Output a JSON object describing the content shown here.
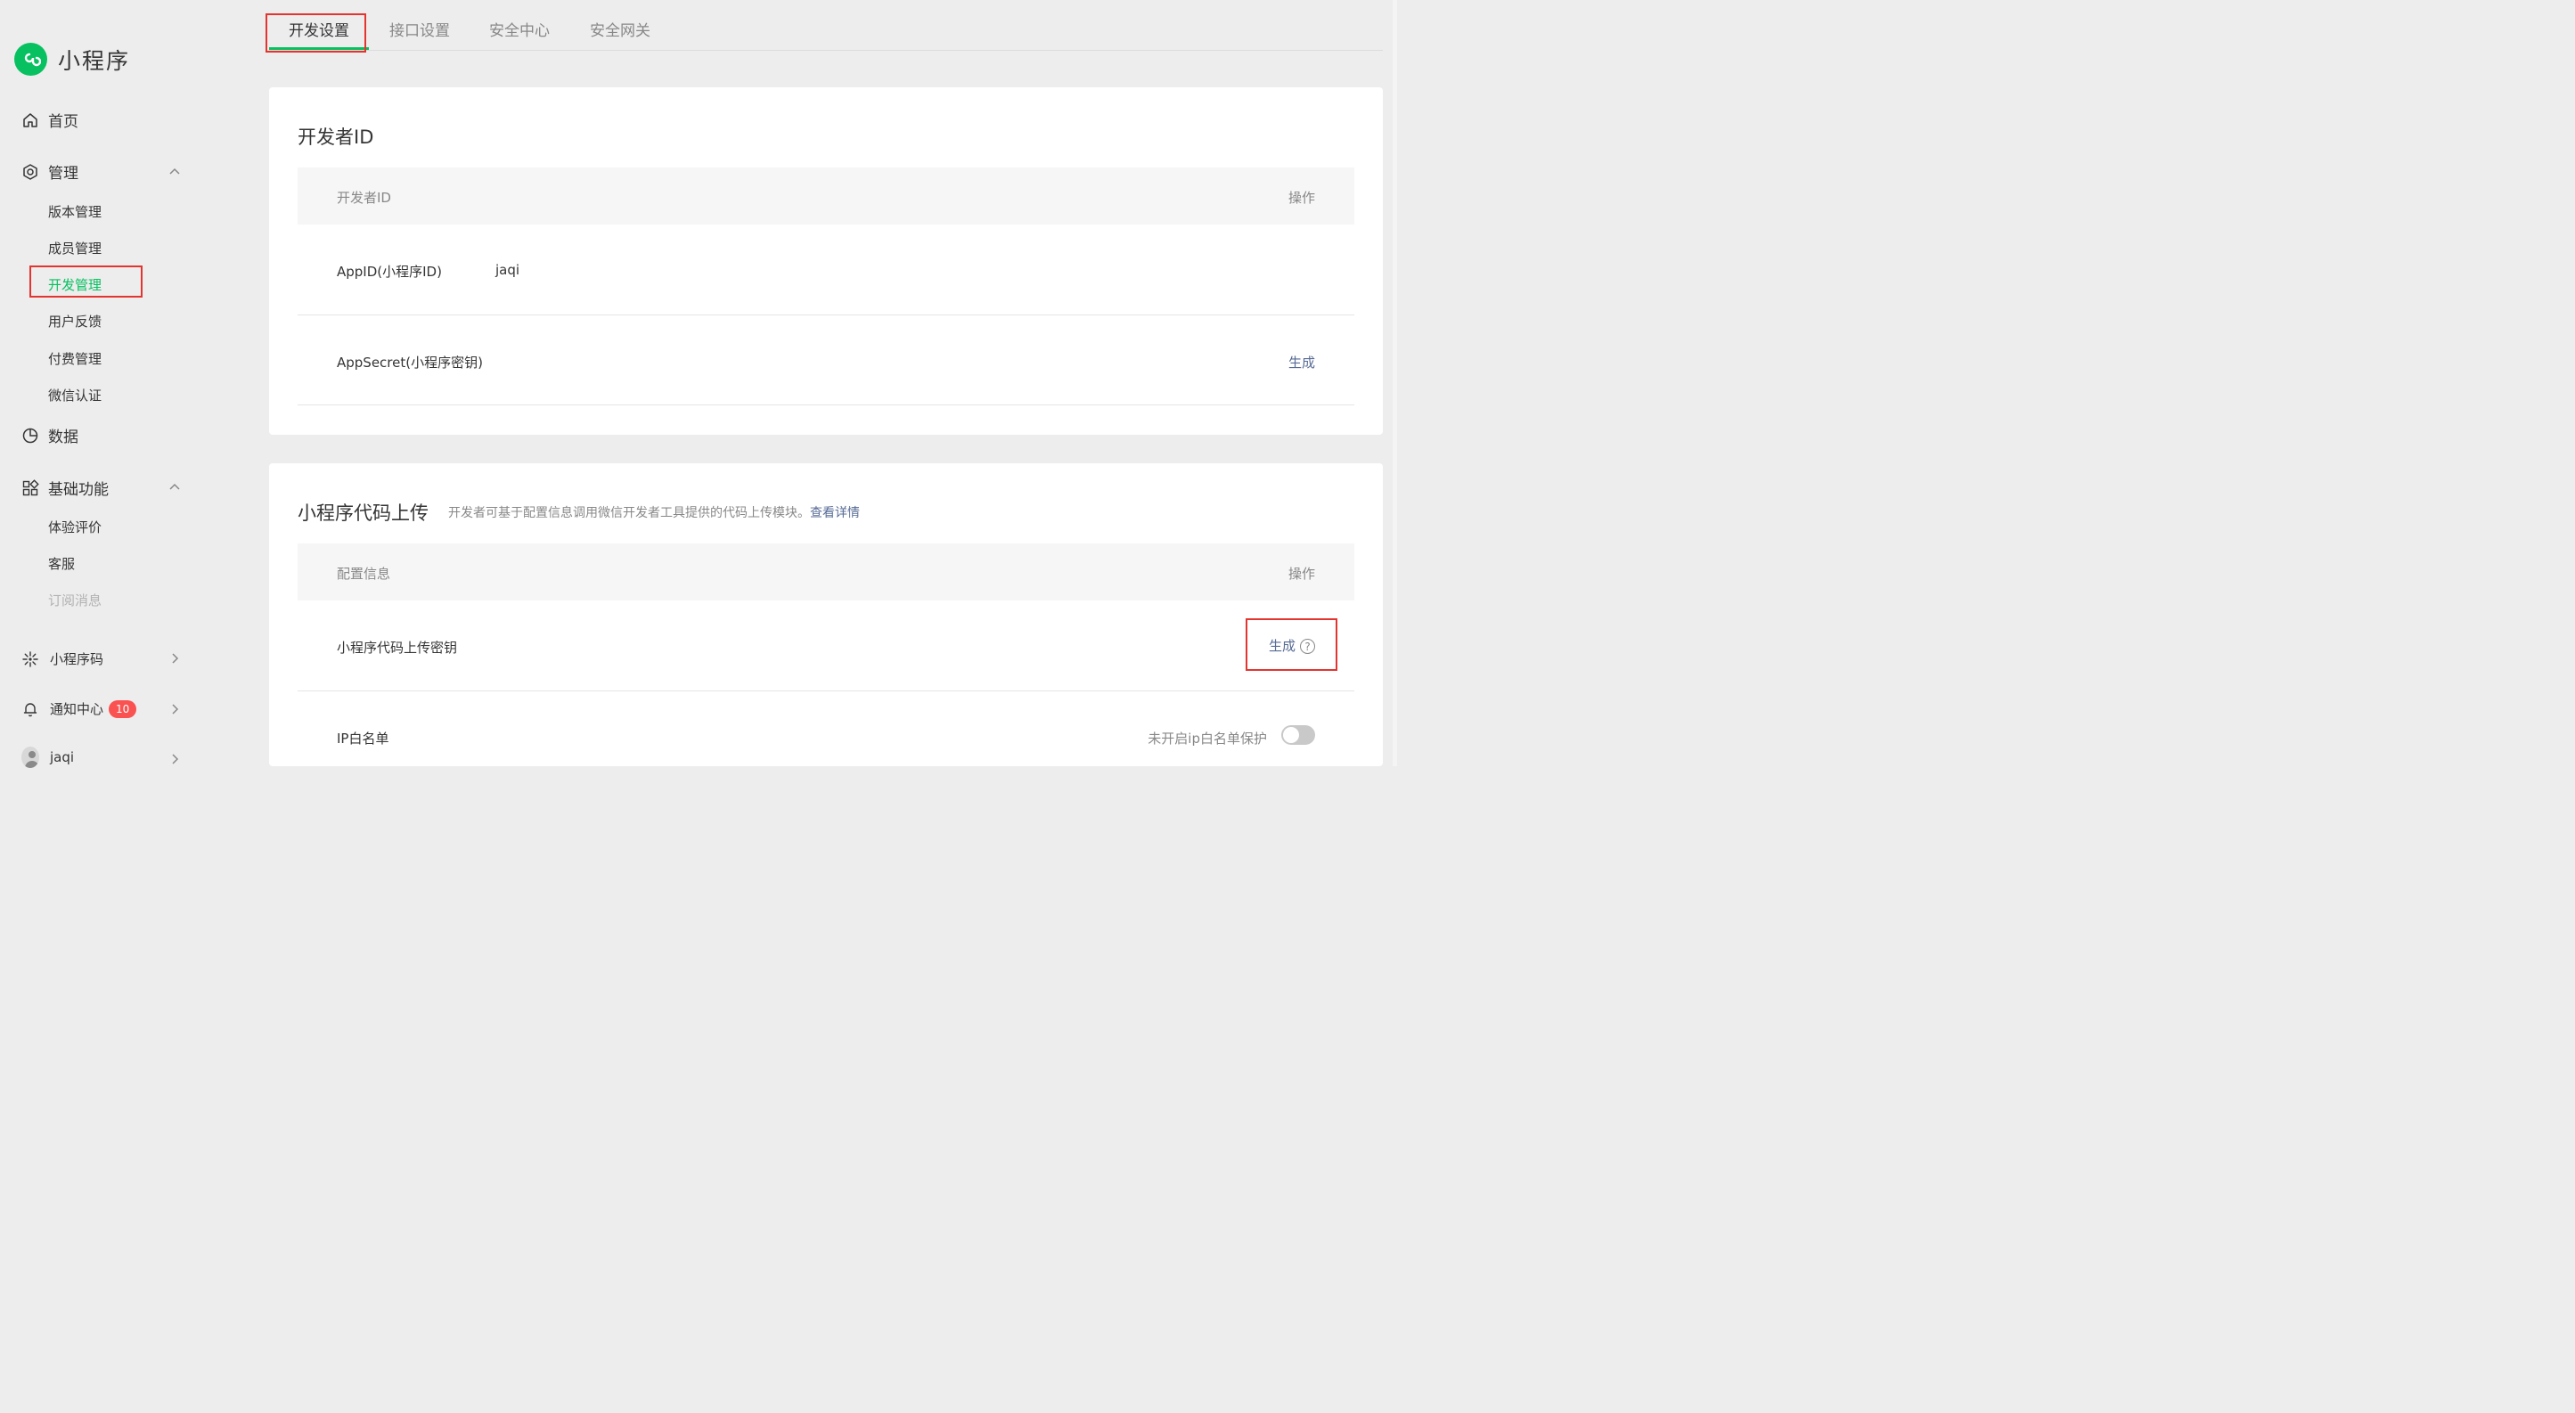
{
  "sidebar": {
    "brand": "小程序",
    "home": "首页",
    "manage": {
      "label": "管理",
      "items": [
        "版本管理",
        "成员管理",
        "开发管理",
        "用户反馈",
        "付费管理",
        "微信认证"
      ]
    },
    "data": "数据",
    "basic": {
      "label": "基础功能",
      "items": [
        "体验评价",
        "客服",
        "订阅消息"
      ]
    },
    "mini_code": "小程序码",
    "notify": {
      "label": "通知中心",
      "badge": "10"
    },
    "user": "jaqi"
  },
  "tabs": [
    "开发设置",
    "接口设置",
    "安全中心",
    "安全网关"
  ],
  "dev_id_panel": {
    "title": "开发者ID",
    "header": {
      "col1": "开发者ID",
      "col2": "操作"
    },
    "rows": [
      {
        "label": "AppID(小程序ID)",
        "value": "jaqi",
        "action": ""
      },
      {
        "label": "AppSecret(小程序密钥)",
        "value": "",
        "action": "生成"
      }
    ]
  },
  "upload_panel": {
    "title": "小程序代码上传",
    "desc": "开发者可基于配置信息调用微信开发者工具提供的代码上传模块。",
    "desc_link": "查看详情",
    "header": {
      "col1": "配置信息",
      "col2": "操作"
    },
    "rows": [
      {
        "label": "小程序代码上传密钥",
        "action": "生成"
      },
      {
        "label": "IP白名单",
        "status": "未开启ip白名单保护"
      }
    ]
  },
  "colors": {
    "accent": "#07c160",
    "link": "#576b95",
    "highlight": "#e4342f",
    "badge": "#fa5151"
  }
}
